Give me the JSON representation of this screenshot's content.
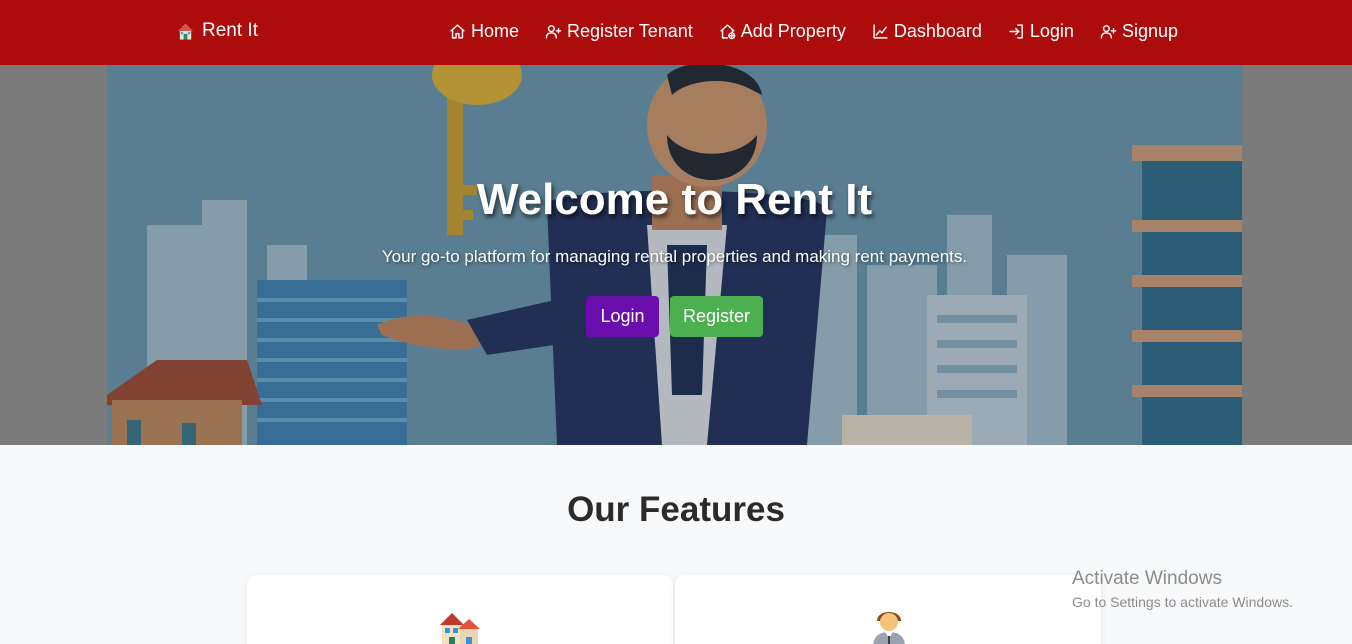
{
  "navbar": {
    "brand": "Rent It",
    "brand_icon": "house-icon",
    "items": [
      {
        "label": "Home",
        "icon": "home-icon"
      },
      {
        "label": "Register Tenant",
        "icon": "user-plus-icon"
      },
      {
        "label": "Add Property",
        "icon": "house-plus-icon"
      },
      {
        "label": "Dashboard",
        "icon": "chart-line-icon"
      },
      {
        "label": "Login",
        "icon": "login-icon"
      },
      {
        "label": "Signup",
        "icon": "user-plus-icon"
      }
    ]
  },
  "hero": {
    "title": "Welcome to Rent It",
    "subtitle": "Your go-to platform for managing rental properties and making rent payments.",
    "login_label": "Login",
    "register_label": "Register"
  },
  "features": {
    "title": "Our Features",
    "cards": [
      {
        "icon": "houses-icon"
      },
      {
        "icon": "person-in-suit-icon"
      }
    ]
  },
  "watermark": {
    "title": "Activate Windows",
    "subtitle": "Go to Settings to activate Windows."
  },
  "colors": {
    "navbar": "#ad0c0c",
    "login_button": "#6a0dad",
    "register_button": "#4caf50",
    "page_background": "#f8f9fa"
  }
}
